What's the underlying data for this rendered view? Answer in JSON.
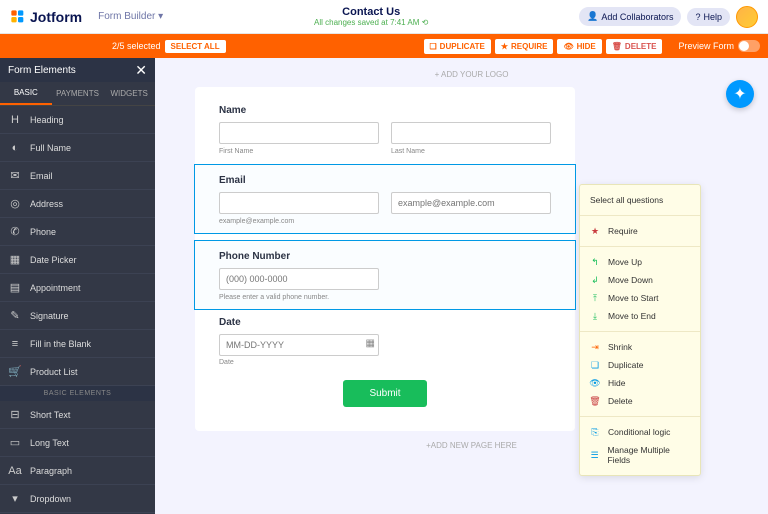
{
  "brand": "Jotform",
  "formBuilder": "Form Builder ▾",
  "title": "Contact Us",
  "savedMsg": "All changes saved at 7:41 AM ⟲",
  "addCollab": "Add Collaborators",
  "help": "Help",
  "orange": {
    "selCount": "2/5 selected",
    "selectAll": "SELECT ALL",
    "duplicate": "DUPLICATE",
    "require": "REQUIRE",
    "hide": "HIDE",
    "delete": "DELETE",
    "preview": "Preview Form"
  },
  "sidebar": {
    "header": "Form Elements",
    "tabs": [
      "BASIC",
      "PAYMENTS",
      "WIDGETS"
    ],
    "items": [
      {
        "icon": "H",
        "label": "Heading"
      },
      {
        "icon": "◐",
        "label": "Full Name"
      },
      {
        "icon": "✉",
        "label": "Email"
      },
      {
        "icon": "◎",
        "label": "Address"
      },
      {
        "icon": "✆",
        "label": "Phone"
      },
      {
        "icon": "▦",
        "label": "Date Picker"
      },
      {
        "icon": "▤",
        "label": "Appointment"
      },
      {
        "icon": "✎",
        "label": "Signature"
      },
      {
        "icon": "≡",
        "label": "Fill in the Blank"
      },
      {
        "icon": "🛒",
        "label": "Product List"
      }
    ],
    "sep": "BASIC ELEMENTS",
    "items2": [
      {
        "icon": "⊟",
        "label": "Short Text"
      },
      {
        "icon": "▭",
        "label": "Long Text"
      },
      {
        "icon": "Aa",
        "label": "Paragraph"
      },
      {
        "icon": "▾",
        "label": "Dropdown"
      }
    ]
  },
  "form": {
    "addLogo": "+ ADD YOUR LOGO",
    "nameLabel": "Name",
    "firstName": "First Name",
    "lastName": "Last Name",
    "emailLabel": "Email",
    "emailPh": "example@example.com",
    "emailHelp": "example@example.com",
    "phoneLabel": "Phone Number",
    "phonePh": "(000) 000-0000",
    "phoneHelp": "Please enter a valid phone number.",
    "dateLabel": "Date",
    "datePh": "MM-DD-YYYY",
    "dateSub": "Date",
    "submit": "Submit",
    "addPage": "+ADD NEW PAGE HERE"
  },
  "ctx": {
    "selectAll": "Select all questions",
    "require": "Require",
    "moveUp": "Move Up",
    "moveDown": "Move Down",
    "moveStart": "Move to Start",
    "moveEnd": "Move to End",
    "shrink": "Shrink",
    "duplicate": "Duplicate",
    "hide": "Hide",
    "delete": "Delete",
    "cond": "Conditional logic",
    "multi": "Manage Multiple Fields"
  }
}
